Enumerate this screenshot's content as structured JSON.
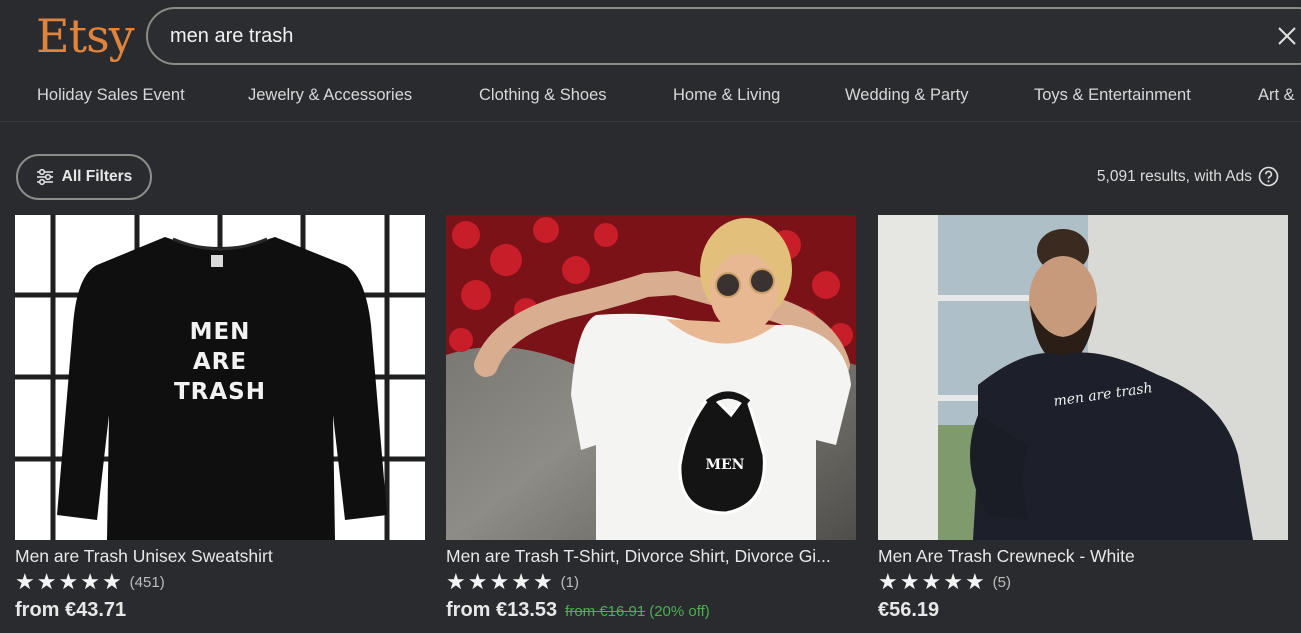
{
  "header": {
    "logo": "Etsy",
    "search_value": "men are trash"
  },
  "categories": [
    "Holiday Sales Event",
    "Jewelry & Accessories",
    "Clothing & Shoes",
    "Home & Living",
    "Wedding & Party",
    "Toys & Entertainment",
    "Art &"
  ],
  "filters": {
    "label": "All Filters",
    "results_text": "5,091 results, with Ads"
  },
  "products": [
    {
      "title": "Men are Trash Unisex Sweatshirt",
      "image_text": [
        "MEN",
        "ARE",
        "TRASH"
      ],
      "stars": 5,
      "reviews": "(451)",
      "price": "from €43.71"
    },
    {
      "title": "Men are Trash T-Shirt, Divorce Shirt, Divorce Gi...",
      "image_text": [
        "MEN"
      ],
      "stars": 5,
      "reviews": "(1)",
      "price": "from €13.53",
      "original_price": "from €16.91",
      "discount": "(20% off)"
    },
    {
      "title": "Men Are Trash Crewneck - White",
      "image_text": [
        "men are trash"
      ],
      "stars": 5,
      "reviews": "(5)",
      "price": "€56.19"
    }
  ],
  "colors": {
    "background": "#2a2b2e",
    "brand": "#e0833d",
    "discount": "#4caf50"
  }
}
